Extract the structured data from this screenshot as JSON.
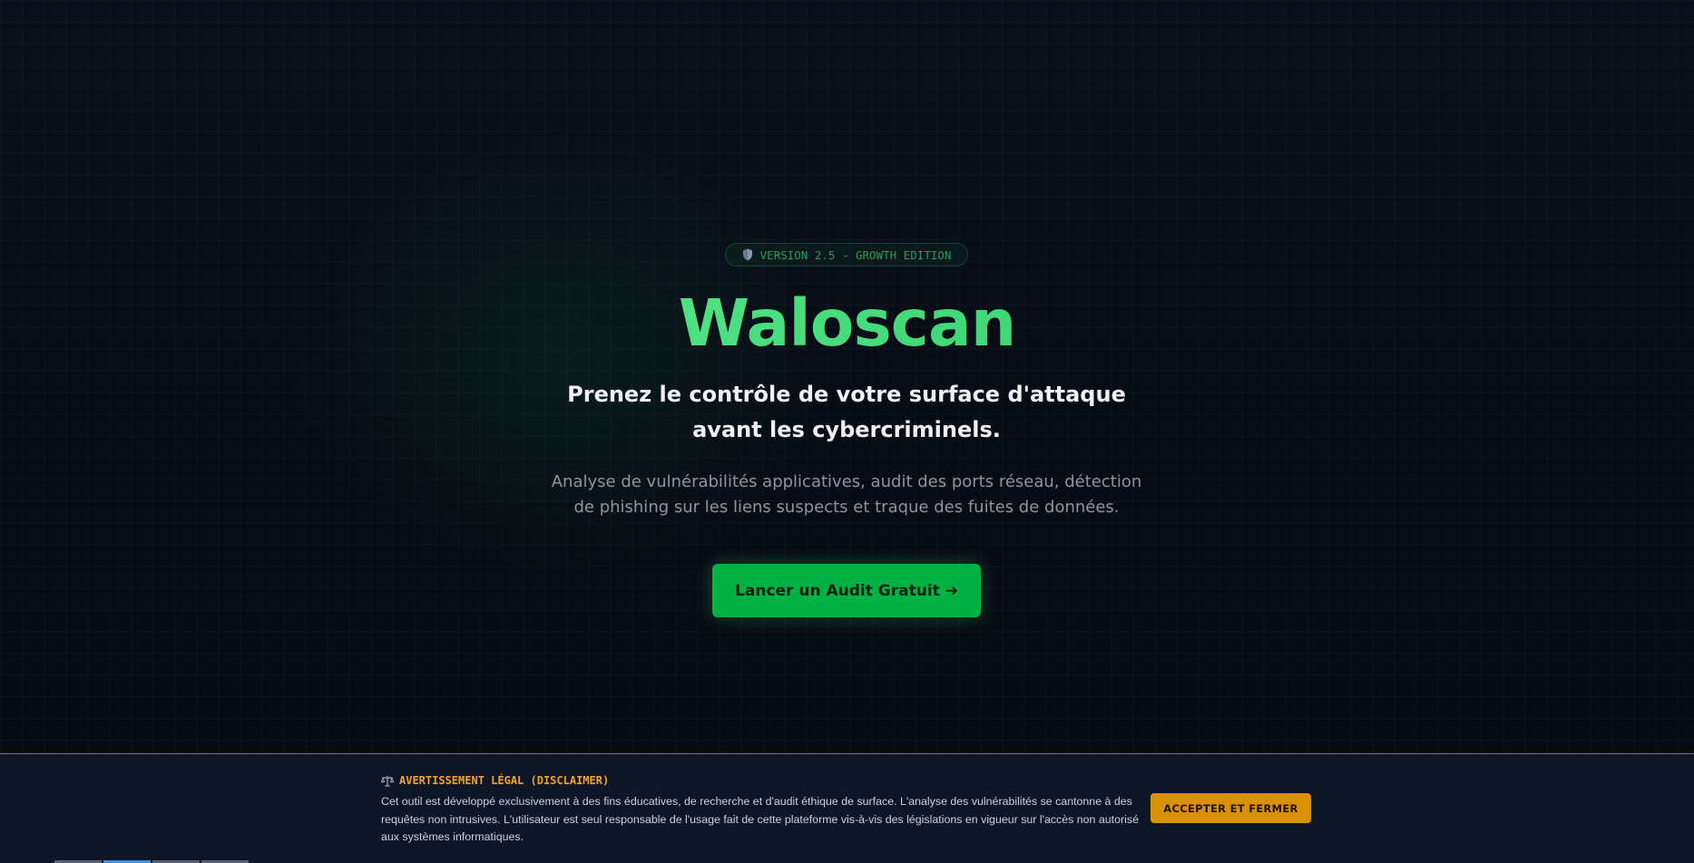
{
  "hero": {
    "badge": {
      "icon": "shield-icon",
      "text": "VERSION 2.5 - GROWTH EDITION"
    },
    "title": "Waloscan",
    "headline": "Prenez le contrôle de votre surface d'attaque avant les cybercriminels.",
    "description": "Analyse de vulnérabilités applicatives, audit des ports réseau, détection de phishing sur les liens suspects et traque des fuites de données.",
    "cta_label": "Lancer un Audit Gratuit ➔"
  },
  "disclaimer": {
    "icon": "scales-icon",
    "title": "AVERTISSEMENT LÉGAL (DISCLAIMER)",
    "text": "Cet outil est développé exclusivement à des fins éducatives, de recherche et d'audit éthique de surface. L'analyse des vulnérabilités se cantonne à des requêtes non intrusives. L'utilisateur est seul responsable de l'usage fait de cette plateforme vis-à-vis des législations en vigueur sur l'accès non autorisé aux systèmes informatiques.",
    "accept_label": "ACCEPTER ET FERMER"
  },
  "colors": {
    "background": "#070b14",
    "accent_green": "#22c55e",
    "cta_green": "#00b243",
    "warning_amber": "#d9900b",
    "disclaimer_bg": "#0d1626"
  }
}
